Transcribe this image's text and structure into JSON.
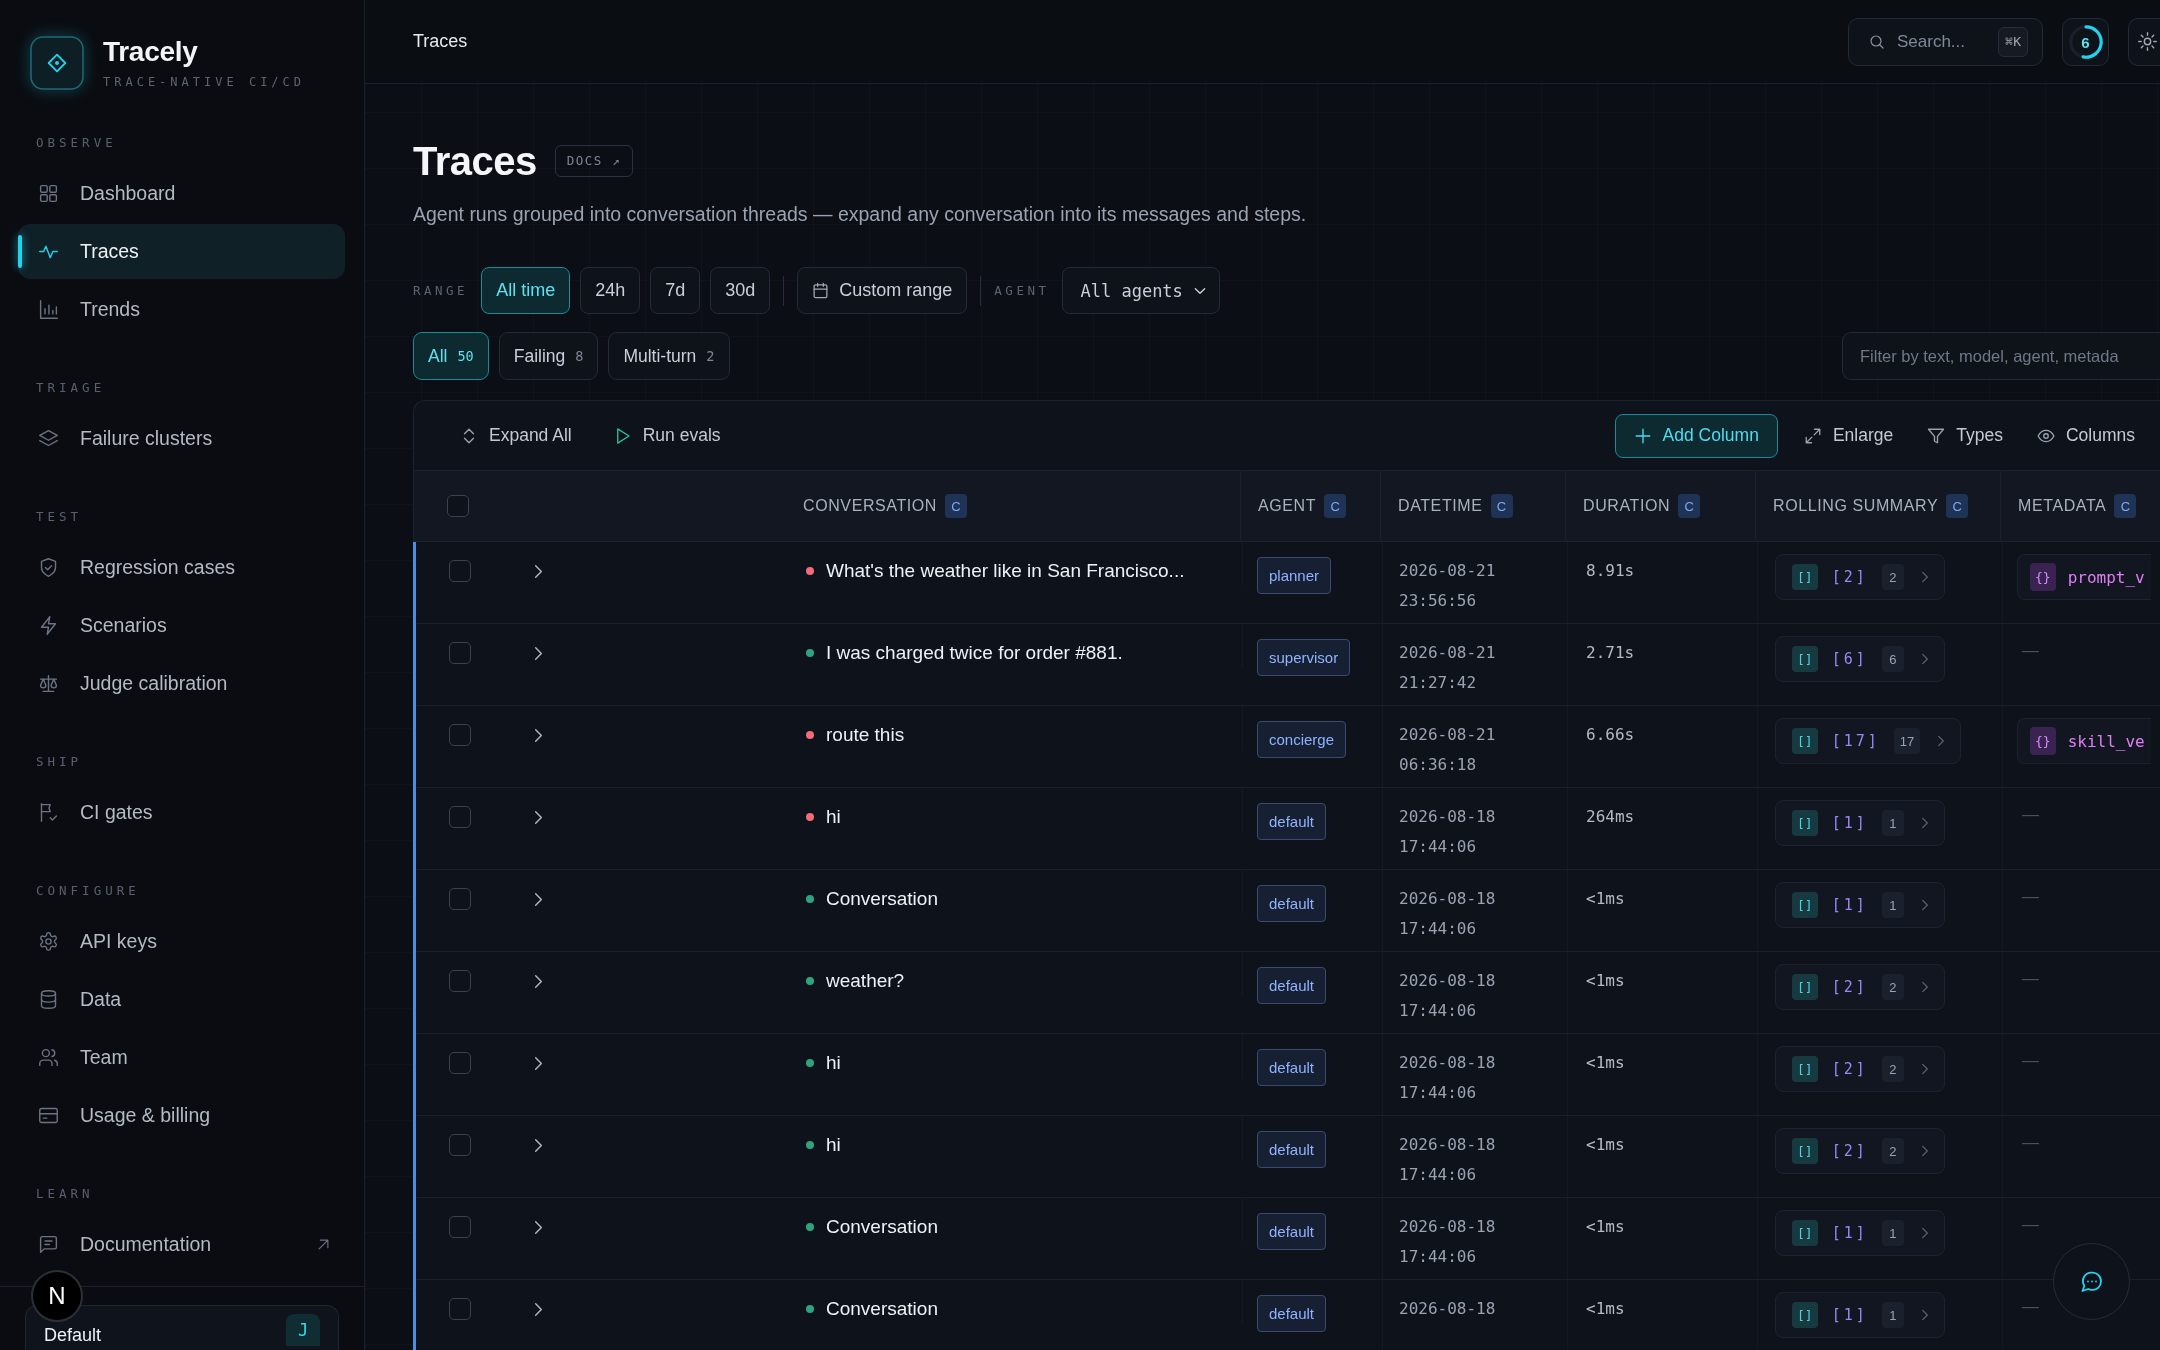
{
  "brand": {
    "name": "Tracely",
    "tagline": "TRACE-NATIVE CI/CD"
  },
  "sidebar": {
    "sections": [
      {
        "label": "OBSERVE",
        "items": [
          {
            "label": "Dashboard",
            "selected": false,
            "external": false
          },
          {
            "label": "Traces",
            "selected": true,
            "external": false
          },
          {
            "label": "Trends",
            "selected": false,
            "external": false
          }
        ]
      },
      {
        "label": "TRIAGE",
        "items": [
          {
            "label": "Failure clusters",
            "selected": false,
            "external": false
          }
        ]
      },
      {
        "label": "TEST",
        "items": [
          {
            "label": "Regression cases",
            "selected": false,
            "external": false
          },
          {
            "label": "Scenarios",
            "selected": false,
            "external": false
          },
          {
            "label": "Judge calibration",
            "selected": false,
            "external": false
          }
        ]
      },
      {
        "label": "SHIP",
        "items": [
          {
            "label": "CI gates",
            "selected": false,
            "external": false
          }
        ]
      },
      {
        "label": "CONFIGURE",
        "items": [
          {
            "label": "API keys",
            "selected": false,
            "external": false
          },
          {
            "label": "Data",
            "selected": false,
            "external": false
          },
          {
            "label": "Team",
            "selected": false,
            "external": false
          },
          {
            "label": "Usage & billing",
            "selected": false,
            "external": false
          }
        ]
      },
      {
        "label": "LEARN",
        "items": [
          {
            "label": "Documentation",
            "selected": false,
            "external": true
          }
        ]
      }
    ],
    "dev_badge": "N",
    "workspace": {
      "name": "Default",
      "avatar": "J"
    }
  },
  "header": {
    "breadcrumb": "Traces",
    "search": {
      "placeholder": "Search...",
      "shortcut": "⌘K"
    },
    "progress": {
      "count": "6",
      "level": 0.53
    }
  },
  "page": {
    "title": "Traces",
    "docs": "DOCS ↗",
    "description": "Agent runs grouped into conversation threads — expand any conversation into its messages and steps."
  },
  "range": {
    "label": "RANGE",
    "options": [
      {
        "label": "All time",
        "selected": true
      },
      {
        "label": "24h",
        "selected": false
      },
      {
        "label": "7d",
        "selected": false
      },
      {
        "label": "30d",
        "selected": false
      }
    ],
    "custom": "Custom range"
  },
  "agent_filter": {
    "label": "AGENT",
    "value": "All agents"
  },
  "filters": [
    {
      "label": "All",
      "count": "50",
      "selected": true
    },
    {
      "label": "Failing",
      "count": "8",
      "selected": false
    },
    {
      "label": "Multi-turn",
      "count": "2",
      "selected": false
    }
  ],
  "filter_field": {
    "placeholder": "Filter by text, model, agent, metada"
  },
  "toolbar": {
    "left": [
      {
        "label": "Expand All",
        "kind": "plain"
      },
      {
        "label": "Run evals",
        "kind": "plain"
      }
    ],
    "right": [
      {
        "label": "Add Column",
        "kind": "primary"
      },
      {
        "label": "Enlarge",
        "kind": "plain"
      },
      {
        "label": "Types",
        "kind": "plain"
      },
      {
        "label": "Columns",
        "kind": "plain"
      }
    ]
  },
  "table": {
    "header_checked": false,
    "columns": [
      {
        "label": "CONVERSATION",
        "badge": "C"
      },
      {
        "label": "AGENT",
        "badge": "C"
      },
      {
        "label": "DATETIME",
        "badge": "C"
      },
      {
        "label": "DURATION",
        "badge": "C"
      },
      {
        "label": "ROLLING SUMMARY",
        "badge": "C"
      },
      {
        "label": "METADATA",
        "badge": "C"
      }
    ],
    "rows": [
      {
        "checked": false,
        "expanded": false,
        "color": "#f26b7a",
        "conversation": "What's the weather like in San Francisco...",
        "agent": "planner",
        "datetime": "2026-08-21 23:56:56",
        "duration": "8.91s",
        "summary": {
          "tag": "[]",
          "items": "[2]",
          "count": "2"
        },
        "metadata": {
          "kind": "object",
          "tag": "{}",
          "text": "prompt_v"
        }
      },
      {
        "checked": false,
        "expanded": false,
        "color": "#2ea47e",
        "conversation": "I was charged twice for order #881.",
        "agent": "supervisor",
        "datetime": "2026-08-21 21:27:42",
        "duration": "2.71s",
        "summary": {
          "tag": "[]",
          "items": "[6]",
          "count": "6"
        },
        "metadata": {
          "kind": "empty",
          "text": "—"
        }
      },
      {
        "checked": false,
        "expanded": false,
        "color": "#f26b7a",
        "conversation": "route this",
        "agent": "concierge",
        "datetime": "2026-08-21 06:36:18",
        "duration": "6.66s",
        "summary": {
          "tag": "[]",
          "items": "[17]",
          "count": "17"
        },
        "metadata": {
          "kind": "object",
          "tag": "{}",
          "text": "skill_ve"
        }
      },
      {
        "checked": false,
        "expanded": false,
        "color": "#f26b7a",
        "conversation": "hi",
        "agent": "default",
        "datetime": "2026-08-18 17:44:06",
        "duration": "264ms",
        "summary": {
          "tag": "[]",
          "items": "[1]",
          "count": "1"
        },
        "metadata": {
          "kind": "empty",
          "text": "—"
        }
      },
      {
        "checked": false,
        "expanded": false,
        "color": "#2ea47e",
        "conversation": "Conversation",
        "agent": "default",
        "datetime": "2026-08-18 17:44:06",
        "duration": "<1ms",
        "summary": {
          "tag": "[]",
          "items": "[1]",
          "count": "1"
        },
        "metadata": {
          "kind": "empty",
          "text": "—"
        }
      },
      {
        "checked": false,
        "expanded": false,
        "color": "#2ea47e",
        "conversation": "weather?",
        "agent": "default",
        "datetime": "2026-08-18 17:44:06",
        "duration": "<1ms",
        "summary": {
          "tag": "[]",
          "items": "[2]",
          "count": "2"
        },
        "metadata": {
          "kind": "empty",
          "text": "—"
        }
      },
      {
        "checked": false,
        "expanded": false,
        "color": "#2ea47e",
        "conversation": "hi",
        "agent": "default",
        "datetime": "2026-08-18 17:44:06",
        "duration": "<1ms",
        "summary": {
          "tag": "[]",
          "items": "[2]",
          "count": "2"
        },
        "metadata": {
          "kind": "empty",
          "text": "—"
        }
      },
      {
        "checked": false,
        "expanded": false,
        "color": "#2ea47e",
        "conversation": "hi",
        "agent": "default",
        "datetime": "2026-08-18 17:44:06",
        "duration": "<1ms",
        "summary": {
          "tag": "[]",
          "items": "[2]",
          "count": "2"
        },
        "metadata": {
          "kind": "empty",
          "text": "—"
        }
      },
      {
        "checked": false,
        "expanded": false,
        "color": "#2ea47e",
        "conversation": "Conversation",
        "agent": "default",
        "datetime": "2026-08-18 17:44:06",
        "duration": "<1ms",
        "summary": {
          "tag": "[]",
          "items": "[1]",
          "count": "1"
        },
        "metadata": {
          "kind": "empty",
          "text": "—"
        }
      },
      {
        "checked": false,
        "expanded": false,
        "color": "#2ea47e",
        "conversation": "Conversation",
        "agent": "default",
        "datetime": "2026-08-18",
        "duration": "<1ms",
        "summary": {
          "tag": "[]",
          "items": "[1]",
          "count": "1"
        },
        "metadata": {
          "kind": "empty",
          "text": "—"
        }
      }
    ]
  }
}
